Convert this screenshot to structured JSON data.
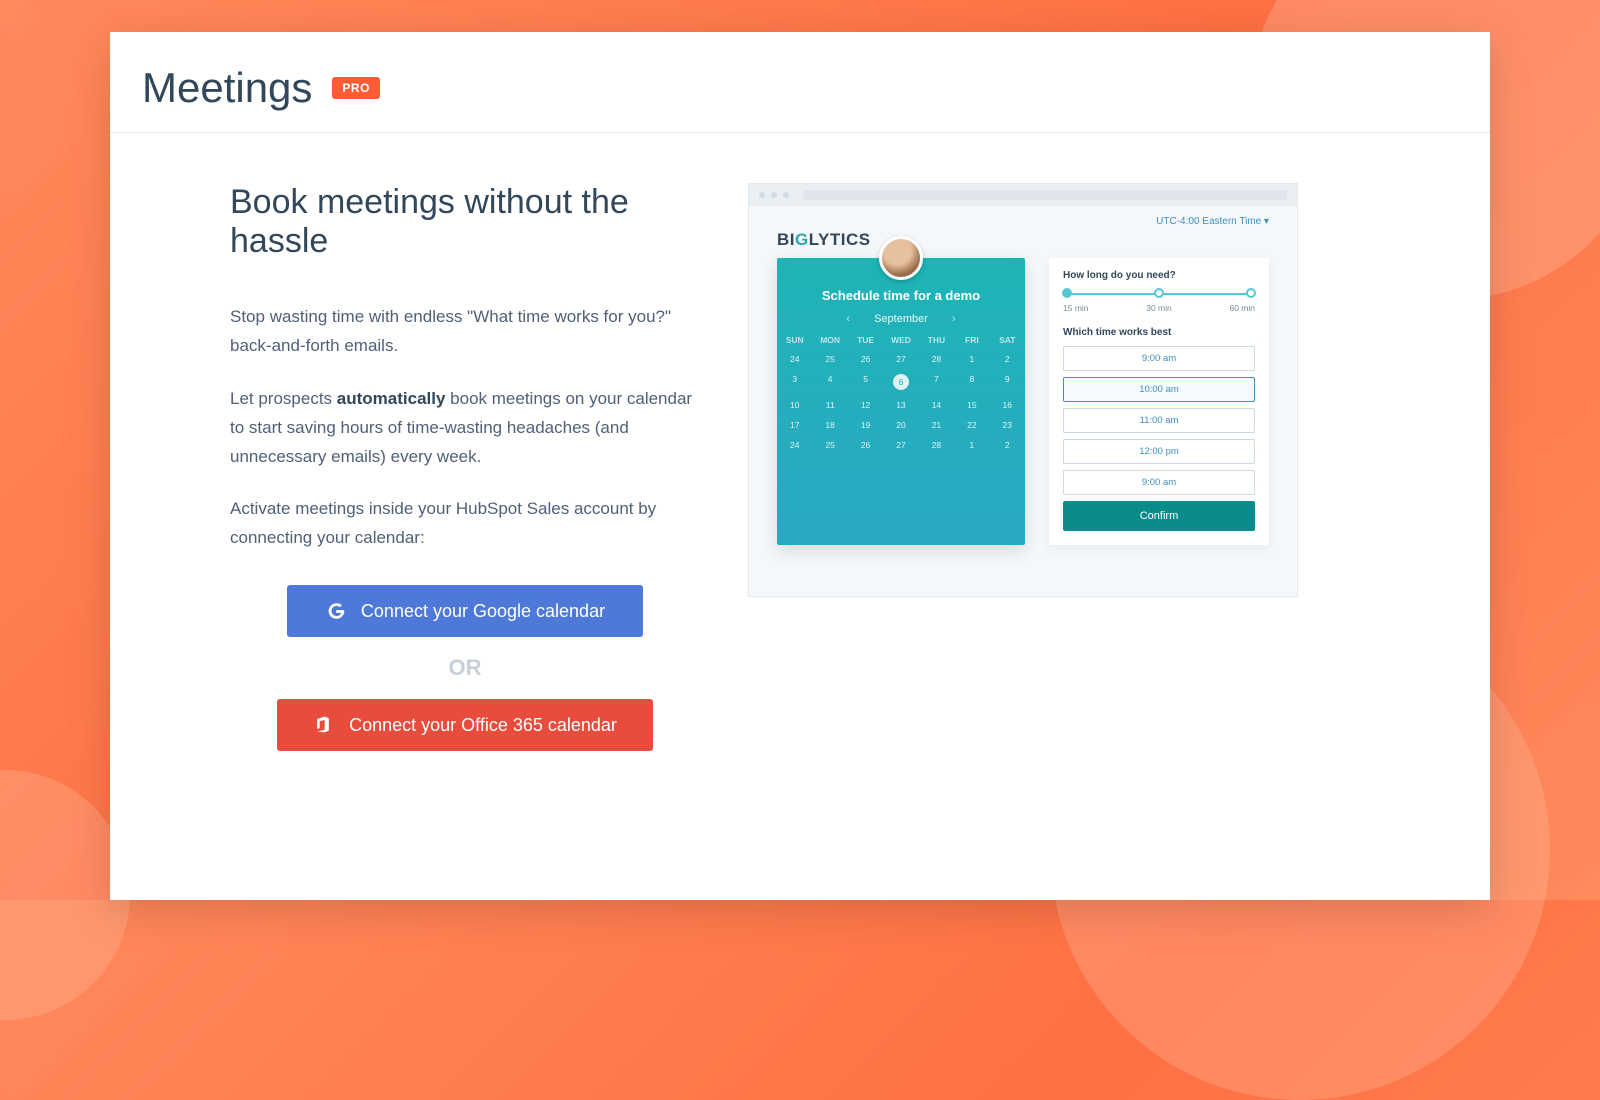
{
  "header": {
    "title": "Meetings",
    "pro_badge": "PRO"
  },
  "hero": {
    "title": "Book meetings without the hassle",
    "para1": "Stop wasting time with endless \"What time works for you?\" back-and-forth emails.",
    "para2_pre": "Let prospects ",
    "para2_strong": "automatically",
    "para2_post": " book meetings on your calendar to start saving hours of time-wasting headaches (and unnecessary emails) every week.",
    "para3": "Activate meetings inside your HubSpot Sales account by connecting your calendar:"
  },
  "actions": {
    "google": "Connect your Google calendar",
    "or": "OR",
    "o365": "Connect your Office 365 calendar"
  },
  "preview": {
    "timezone": "UTC-4:00 Eastern Time ▾",
    "brand_pre": "BI",
    "brand_g": "G",
    "brand_post": "LYTICS",
    "cal": {
      "title": "Schedule time for a demo",
      "month": "September",
      "days": [
        "SUN",
        "MON",
        "TUE",
        "WED",
        "THU",
        "FRI",
        "SAT"
      ],
      "rows": [
        [
          "24",
          "25",
          "26",
          "27",
          "28",
          "1",
          "2"
        ],
        [
          "3",
          "4",
          "5",
          "6",
          "7",
          "8",
          "9"
        ],
        [
          "10",
          "11",
          "12",
          "13",
          "14",
          "15",
          "16"
        ],
        [
          "17",
          "18",
          "19",
          "20",
          "21",
          "22",
          "23"
        ],
        [
          "24",
          "25",
          "26",
          "27",
          "28",
          "1",
          "2"
        ]
      ],
      "selected": "6"
    },
    "picker": {
      "duration_label": "How long do you need?",
      "durations": [
        "15 min",
        "30 min",
        "60 min"
      ],
      "time_label": "Which time works best",
      "slots": [
        "9:00 am",
        "10:00 am",
        "11:00 am",
        "12:00 pm",
        "9:00 am"
      ],
      "selected_slot": "10:00 am",
      "confirm": "Confirm"
    }
  }
}
